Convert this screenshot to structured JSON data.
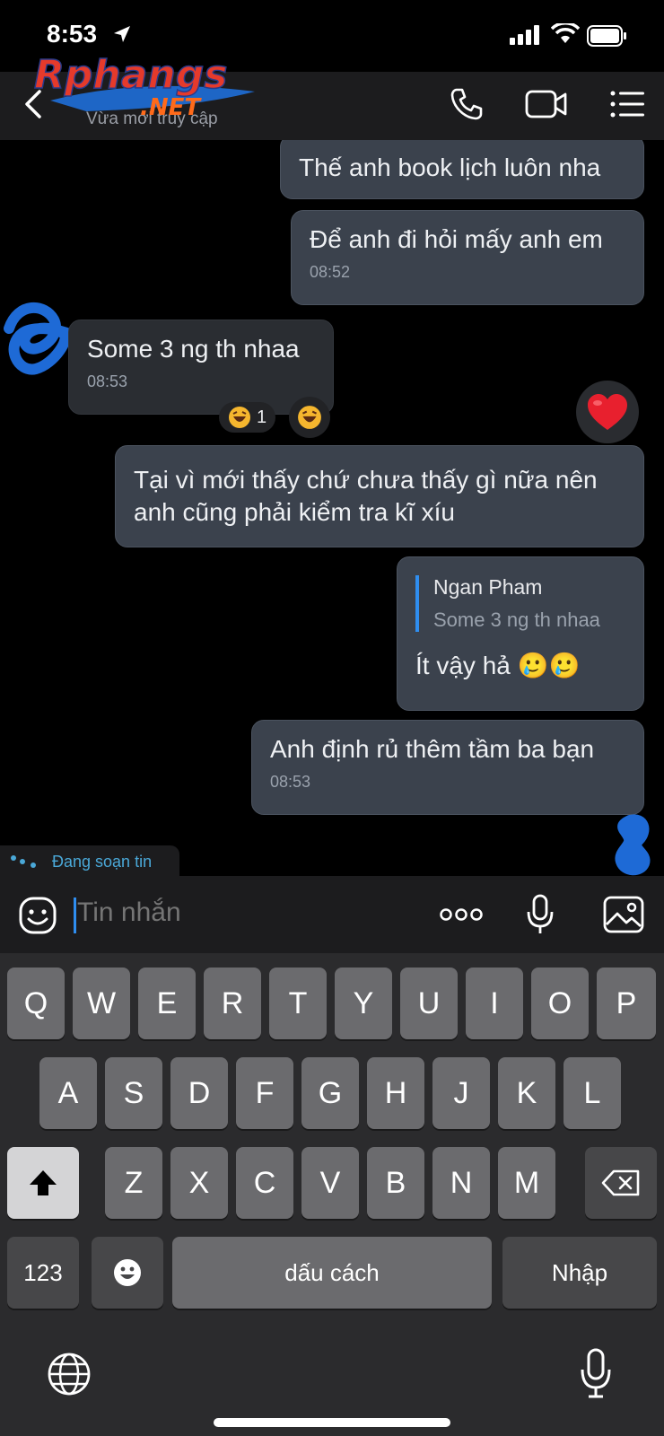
{
  "status_bar": {
    "time": "8:53"
  },
  "header": {
    "last_seen": "Vừa mới truy cập",
    "logo_text": "Rphangs.NET"
  },
  "messages": [
    {
      "dir": "out",
      "text": "Thế anh book lịch luôn nha",
      "time": ""
    },
    {
      "dir": "out",
      "text": "Để anh đi hỏi mấy anh em",
      "time": "08:52"
    },
    {
      "dir": "in",
      "text": "Some 3 ng th nhaa",
      "time": "08:53",
      "reaction_count": "1"
    },
    {
      "dir": "out",
      "text": "Tại vì mới thấy chứ chưa thấy gì nữa nên\nanh cũng phải kiểm tra kĩ xíu",
      "time": ""
    },
    {
      "dir": "out",
      "quote_name": "Ngan Pham",
      "quote_text": "Some 3 ng th nhaa",
      "text": "Ít vậy hả 🥲🥲",
      "time": ""
    },
    {
      "dir": "out",
      "text": "Anh định rủ thêm tầm ba bạn",
      "time": "08:53"
    }
  ],
  "typing_indicator": "Đang soạn tin",
  "composer": {
    "placeholder": "Tin nhắn"
  },
  "keyboard": {
    "row1": [
      "Q",
      "W",
      "E",
      "R",
      "T",
      "Y",
      "U",
      "I",
      "O",
      "P"
    ],
    "row2": [
      "A",
      "S",
      "D",
      "F",
      "G",
      "H",
      "J",
      "K",
      "L"
    ],
    "row3": [
      "Z",
      "X",
      "C",
      "V",
      "B",
      "N",
      "M"
    ],
    "numbers": "123",
    "space": "dấu cách",
    "enter": "Nhập"
  },
  "colors": {
    "accent": "#2f8ef0",
    "bubble_out": "#3b424d",
    "bubble_in": "#2a2d32",
    "typing": "#4aa8d8"
  }
}
